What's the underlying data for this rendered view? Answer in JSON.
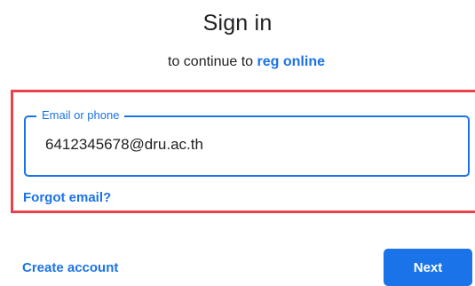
{
  "header": {
    "title": "Sign in",
    "subtitle_prefix": "to continue to",
    "app_name": "reg online"
  },
  "email_field": {
    "label": "Email or phone",
    "value": "6412345678@dru.ac.th"
  },
  "links": {
    "forgot_email": "Forgot email?",
    "create_account": "Create account"
  },
  "actions": {
    "next_label": "Next"
  },
  "colors": {
    "accent": "#1a73e8",
    "highlight": "#e8434d",
    "text": "#202124"
  }
}
